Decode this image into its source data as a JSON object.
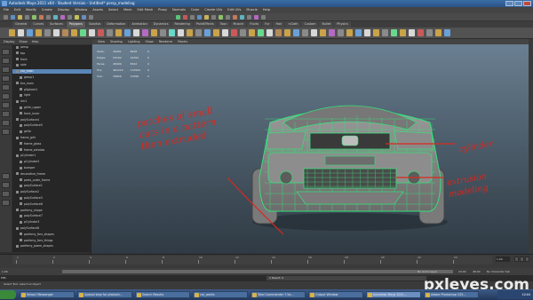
{
  "window": {
    "title": "Autodesk Maya 2011 x64 - Student Version - Untitled*    persp_modeling"
  },
  "menubar": [
    "File",
    "Edit",
    "Modify",
    "Create",
    "Display",
    "Window",
    "Assets",
    "Select",
    "Mesh",
    "Edit Mesh",
    "Proxy",
    "Normals",
    "Color",
    "Create UVs",
    "Edit UVs",
    "Muscle",
    "Help"
  ],
  "shelf_tabs": [
    "General",
    "Curves",
    "Surfaces",
    "Polygons",
    "Subdivs",
    "Deformation",
    "Animation",
    "Dynamics",
    "Rendering",
    "PaintEffects",
    "Toon",
    "Muscle",
    "Fluids",
    "Fur",
    "Hair",
    "nCloth",
    "Custom",
    "Bullet",
    "Physics"
  ],
  "shelf_active_tab": "Polygons",
  "outliner": {
    "menu": [
      "Display",
      "Show",
      "Help"
    ],
    "items": [
      {
        "label": "persp",
        "selected": false
      },
      {
        "label": "top",
        "selected": false
      },
      {
        "label": "front",
        "selected": false
      },
      {
        "label": "side",
        "selected": false
      },
      {
        "label": "car_main",
        "selected": true
      },
      {
        "label": "group1",
        "selected": false
      },
      {
        "label": "tire_main",
        "selected": false
      },
      {
        "label": "pSphere1",
        "selected": false
      },
      {
        "label": "light",
        "selected": false
      },
      {
        "label": "rim1",
        "selected": false
      },
      {
        "label": "grille_upper",
        "selected": false
      },
      {
        "label": "front_inner",
        "selected": false
      },
      {
        "label": "polySurface4",
        "selected": false
      },
      {
        "label": "polySurface5",
        "selected": false
      },
      {
        "label": "grille",
        "selected": false
      },
      {
        "label": "frame_grill",
        "selected": false
      },
      {
        "label": "frame_glass",
        "selected": false
      },
      {
        "label": "frame_window",
        "selected": false
      },
      {
        "label": "pCylinder1",
        "selected": false
      },
      {
        "label": "pCylinder2",
        "selected": false
      },
      {
        "label": "bumper",
        "selected": false
      },
      {
        "label": "decorative_frame",
        "selected": false
      },
      {
        "label": "parts_outer_frame",
        "selected": false
      },
      {
        "label": "polySurface1",
        "selected": false
      },
      {
        "label": "polySurface2",
        "selected": false
      },
      {
        "label": "polySurface3",
        "selected": false
      },
      {
        "label": "polySurface6",
        "selected": false
      },
      {
        "label": "parfemy_shape",
        "selected": false
      },
      {
        "label": "polySurface7",
        "selected": false
      },
      {
        "label": "pCylinder3",
        "selected": false
      },
      {
        "label": "polySurface8",
        "selected": false
      },
      {
        "label": "parfemy_fors_shapes",
        "selected": false
      },
      {
        "label": "parfemy_fors_things",
        "selected": false
      },
      {
        "label": "parfemy_poem_shapes",
        "selected": false
      }
    ]
  },
  "viewport": {
    "panel_menu": [
      "View",
      "Shading",
      "Lighting",
      "Show",
      "Renderer",
      "Panels"
    ],
    "hud": [
      {
        "label": "Verts:",
        "a": "29261",
        "b": "8428",
        "c": "0"
      },
      {
        "label": "Edges:",
        "a": "53102",
        "b": "16762",
        "c": "0"
      },
      {
        "label": "Faces:",
        "a": "26999",
        "b": "8342",
        "c": "0"
      },
      {
        "label": "Tris:",
        "a": "461219",
        "b": "172952",
        "c": "0"
      },
      {
        "label": "UVs:",
        "a": "30826",
        "b": "17086",
        "c": "0"
      }
    ],
    "wire_color": "#35e07a",
    "annotations": {
      "left": [
        "patches of small",
        "cuts in a pattern",
        "then extruded"
      ],
      "right_top": "cylinder",
      "right_bottom": [
        "extrusion",
        "modeling"
      ]
    },
    "annotation_color": "#d9281f"
  },
  "timeline": {
    "ticks": [
      "1",
      "2",
      "4",
      "6",
      "8",
      "10",
      "12",
      "14",
      "16",
      "18",
      "20",
      "22",
      "24"
    ],
    "current_frame": "1.00",
    "range_start": "1.00",
    "range_end": "24.00",
    "range_end2": "48.00",
    "anim_layer": "No Anim Layer",
    "char_set": "No Character Set"
  },
  "command_line": {
    "prefix": "MEL",
    "result": "// Result: 0"
  },
  "help_line": "Select Tool: select an object",
  "taskbar": {
    "items": [
      {
        "label": "Yahoo! Messenger",
        "active": false
      },
      {
        "label": "Upload step for photosh...",
        "active": false
      },
      {
        "label": "Search Results",
        "active": false
      },
      {
        "label": "car_works",
        "active": false
      },
      {
        "label": "Total Commander 7.5a...",
        "active": false
      },
      {
        "label": "Output Window",
        "active": false
      },
      {
        "label": "Autodesk Maya 2011...",
        "active": true
      },
      {
        "label": "Adobe Photoshop CS5...",
        "active": false
      }
    ],
    "clock": "10:04"
  },
  "watermark": "pxleyes.com"
}
